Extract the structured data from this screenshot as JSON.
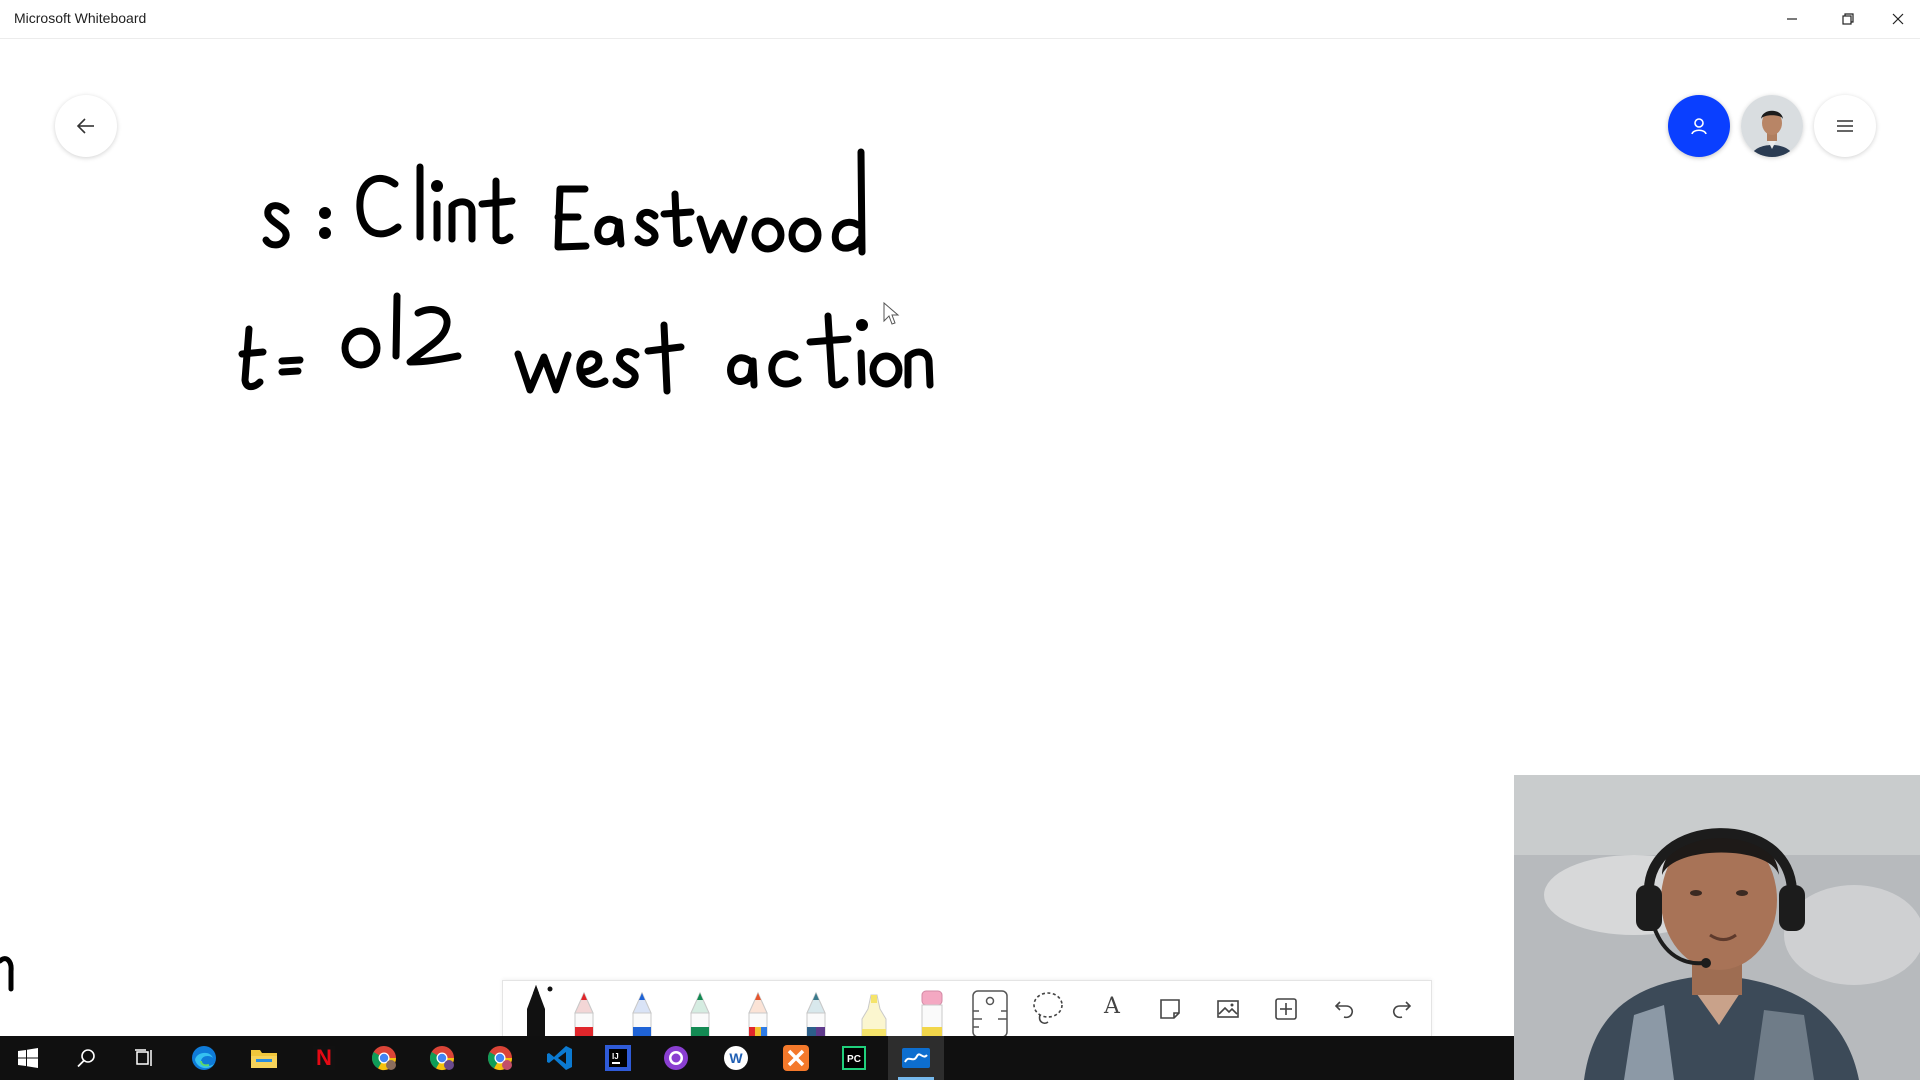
{
  "window": {
    "title": "Microsoft Whiteboard",
    "controls": [
      "minimize-icon",
      "restore-icon",
      "close-icon"
    ]
  },
  "canvas": {
    "ink_lines": [
      "s : Clint Eastwood",
      "t= old west action"
    ],
    "edge_ink": "n",
    "buttons": [
      "back-arrow-icon",
      "share-person-icon",
      "user-avatar",
      "hamburger-menu-icon"
    ],
    "accent_color": "#0a3fff"
  },
  "toolbar": {
    "pens": [
      {
        "name": "black-pen",
        "color": "#111111",
        "selected": true
      },
      {
        "name": "red-pen",
        "color": "#e0262b"
      },
      {
        "name": "blue-pen",
        "color": "#1f63d6"
      },
      {
        "name": "green-pen",
        "color": "#138a53"
      },
      {
        "name": "rainbow-pen",
        "color": "#e6552d"
      },
      {
        "name": "galaxy-pen",
        "color": "#3a7a8c"
      },
      {
        "name": "highlighter",
        "color": "#f5e46b"
      },
      {
        "name": "eraser",
        "color": "#f4a8c2"
      }
    ],
    "tools": [
      "ruler-icon",
      "lasso-icon",
      "text-icon",
      "sticky-note-icon",
      "image-icon",
      "add-icon",
      "undo-icon",
      "redo-icon"
    ],
    "text_tool_glyph": "A"
  },
  "taskbar": {
    "items": [
      "start-icon",
      "search-icon",
      "task-view-icon",
      "edge-icon",
      "file-explorer-icon",
      "netflix-icon",
      "chrome-icon",
      "chrome-profile-2-icon",
      "chrome-profile-3-icon",
      "vscode-icon",
      "intellij-icon",
      "github-desktop-icon",
      "word-icon",
      "xampp-icon",
      "pycharm-icon",
      "whiteboard-icon"
    ],
    "active_item": "whiteboard-icon",
    "netflix_glyph": "N",
    "word_glyph": "W",
    "pycharm_glyph": "PC"
  }
}
